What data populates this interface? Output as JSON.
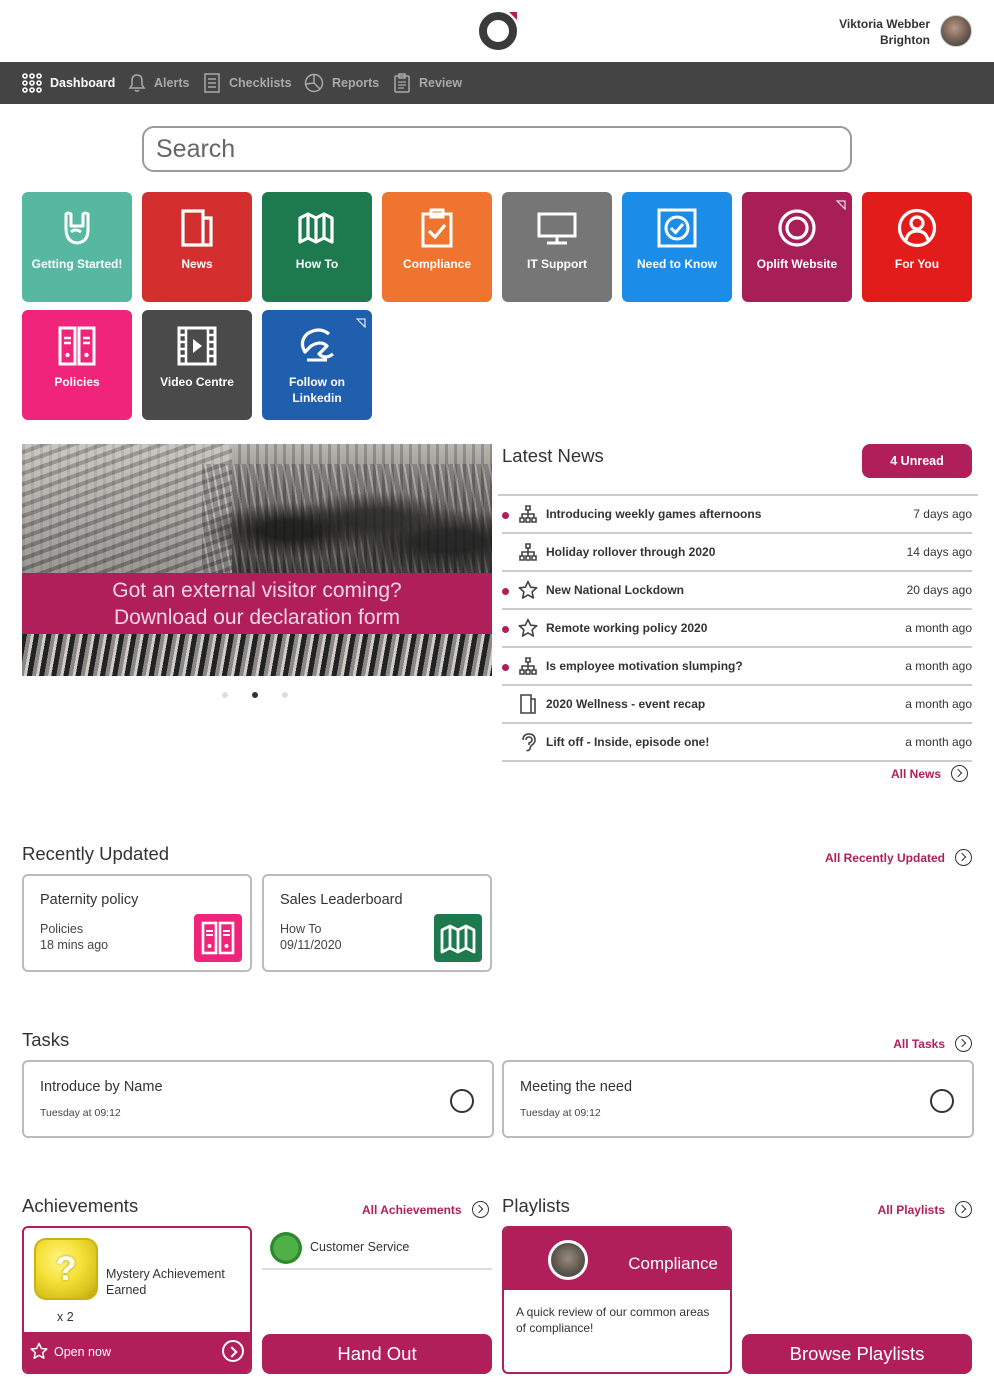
{
  "header": {
    "user_name": "Viktoria Webber",
    "user_location": "Brighton"
  },
  "nav": {
    "items": [
      {
        "label": "Dashboard",
        "icon": "grid-icon",
        "active": true
      },
      {
        "label": "Alerts",
        "icon": "bell-icon",
        "active": false
      },
      {
        "label": "Checklists",
        "icon": "checklist-icon",
        "active": false
      },
      {
        "label": "Reports",
        "icon": "pie-chart-icon",
        "active": false
      },
      {
        "label": "Review",
        "icon": "clipboard-icon",
        "active": false
      }
    ]
  },
  "search": {
    "placeholder": "Search"
  },
  "tiles": [
    {
      "label": "Getting Started!",
      "color": "#56b8a0",
      "icon": "rock-hand-icon"
    },
    {
      "label": "News",
      "color": "#d32f2f",
      "icon": "document-icon"
    },
    {
      "label": "How To",
      "color": "#1d7a4f",
      "icon": "map-icon"
    },
    {
      "label": "Compliance",
      "color": "#ee7430",
      "icon": "clipboard-check-icon"
    },
    {
      "label": "IT Support",
      "color": "#767676",
      "icon": "monitor-icon"
    },
    {
      "label": "Need to Know",
      "color": "#1b8de8",
      "icon": "check-badge-icon"
    },
    {
      "label": "Oplift Website",
      "color": "#a81e57",
      "icon": "target-icon"
    },
    {
      "label": "For You",
      "color": "#e21b1b",
      "icon": "user-circle-icon"
    },
    {
      "label": "Policies",
      "color": "#f0247a",
      "icon": "binders-icon"
    },
    {
      "label": "Video Centre",
      "color": "#4a4a4a",
      "icon": "film-icon"
    },
    {
      "label": "Follow on Linkedin",
      "color": "#1f5fad",
      "icon": "linkedin-swirl-icon"
    }
  ],
  "banner": {
    "line1": "Got an external visitor coming?",
    "line2": "Download our declaration form",
    "slide_count": 3,
    "active_slide": 2
  },
  "latest_news": {
    "title": "Latest News",
    "unread_label": "4 Unread",
    "items": [
      {
        "title": "Introducing weekly games afternoons",
        "time": "7 days ago",
        "unread": true,
        "icon": "org-chart-icon"
      },
      {
        "title": "Holiday rollover through 2020",
        "time": "14 days ago",
        "unread": false,
        "icon": "org-chart-icon"
      },
      {
        "title": "New National Lockdown",
        "time": "20 days ago",
        "unread": true,
        "icon": "star-icon"
      },
      {
        "title": "Remote working policy 2020",
        "time": "a month ago",
        "unread": true,
        "icon": "star-icon"
      },
      {
        "title": "Is employee motivation slumping?",
        "time": "a month ago",
        "unread": true,
        "icon": "org-chart-icon"
      },
      {
        "title": "2020 Wellness - event recap",
        "time": "a month ago",
        "unread": false,
        "icon": "document-icon"
      },
      {
        "title": "Lift off - Inside, episode one!",
        "time": "a month ago",
        "unread": false,
        "icon": "ear-icon"
      }
    ],
    "all_label": "All News"
  },
  "recently_updated": {
    "title": "Recently Updated",
    "all_label": "All Recently Updated",
    "items": [
      {
        "title": "Paternity policy",
        "category": "Policies",
        "time": "18 mins ago",
        "color": "#f0247a",
        "icon": "binders-icon"
      },
      {
        "title": "Sales Leaderboard",
        "category": "How To",
        "time": "09/11/2020",
        "color": "#1d7a4f",
        "icon": "map-icon"
      }
    ]
  },
  "tasks": {
    "title": "Tasks",
    "all_label": "All Tasks",
    "items": [
      {
        "title": "Introduce by Name",
        "time": "Tuesday at 09:12"
      },
      {
        "title": "Meeting the need",
        "time": "Tuesday at 09:12"
      }
    ]
  },
  "achievements": {
    "title": "Achievements",
    "all_label": "All Achievements",
    "card": {
      "text": "Mystery Achievement Earned",
      "count": "x 2",
      "badge": "?",
      "open_label": "Open now"
    },
    "customer_service": "Customer Service",
    "hand_out_label": "Hand Out"
  },
  "playlists": {
    "title": "Playlists",
    "all_label": "All Playlists",
    "card": {
      "title": "Compliance",
      "description": "A quick review of our common areas of compliance!"
    },
    "browse_label": "Browse Playlists"
  },
  "colors": {
    "accent": "#b01f5a",
    "nav_bg": "#444444"
  }
}
